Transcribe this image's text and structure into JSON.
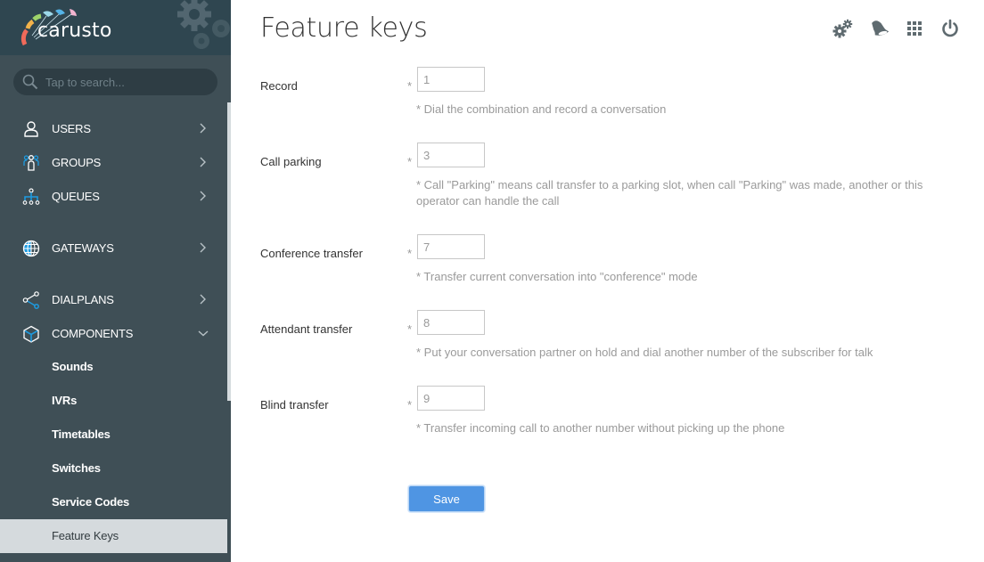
{
  "app": {
    "brand": "carusto"
  },
  "search": {
    "placeholder": "Tap to search..."
  },
  "sidebar": {
    "items": [
      {
        "label": "USERS",
        "icon": "user-icon",
        "expanded": false
      },
      {
        "label": "GROUPS",
        "icon": "groups-icon",
        "expanded": false
      },
      {
        "label": "QUEUES",
        "icon": "queues-icon",
        "expanded": false
      },
      {
        "label": "GATEWAYS",
        "icon": "globe-icon",
        "expanded": false
      },
      {
        "label": "DIALPLANS",
        "icon": "share-icon",
        "expanded": false
      },
      {
        "label": "COMPONENTS",
        "icon": "cube-icon",
        "expanded": true
      }
    ],
    "sub_items": [
      {
        "label": "Sounds"
      },
      {
        "label": "IVRs"
      },
      {
        "label": "Timetables"
      },
      {
        "label": "Switches"
      },
      {
        "label": "Service Codes"
      },
      {
        "label": "Feature Keys",
        "active": true
      }
    ]
  },
  "header": {
    "title": "Feature keys",
    "icons": [
      "settings-gears-icon",
      "bell-icon",
      "apps-grid-icon",
      "power-icon"
    ]
  },
  "form": {
    "fields": [
      {
        "label": "Record",
        "required_mark": "*",
        "value": "1",
        "hint": "* Dial the combination and record a conversation"
      },
      {
        "label": "Call parking",
        "required_mark": "*",
        "value": "3",
        "hint": "* Call \"Parking\" means call transfer to a parking slot, when call \"Parking\" was made, another or this operator can handle the call"
      },
      {
        "label": "Conference transfer",
        "required_mark": "*",
        "value": "7",
        "hint": "* Transfer current conversation into \"conference\" mode"
      },
      {
        "label": "Attendant transfer",
        "required_mark": "*",
        "value": "8",
        "hint": "* Put your conversation partner on hold and dial another number of the subscriber for talk"
      },
      {
        "label": "Blind transfer",
        "required_mark": "*",
        "value": "9",
        "hint": "* Transfer incoming call to another number without picking up the phone"
      }
    ],
    "save_label": "Save"
  },
  "colors": {
    "sidebar_bg": "#3f4f56",
    "sidebar_header_bg": "#2f4650",
    "accent_blue": "#1e9be0",
    "active_item_bg": "#d5dadd",
    "save_button": "#4f95e3"
  }
}
